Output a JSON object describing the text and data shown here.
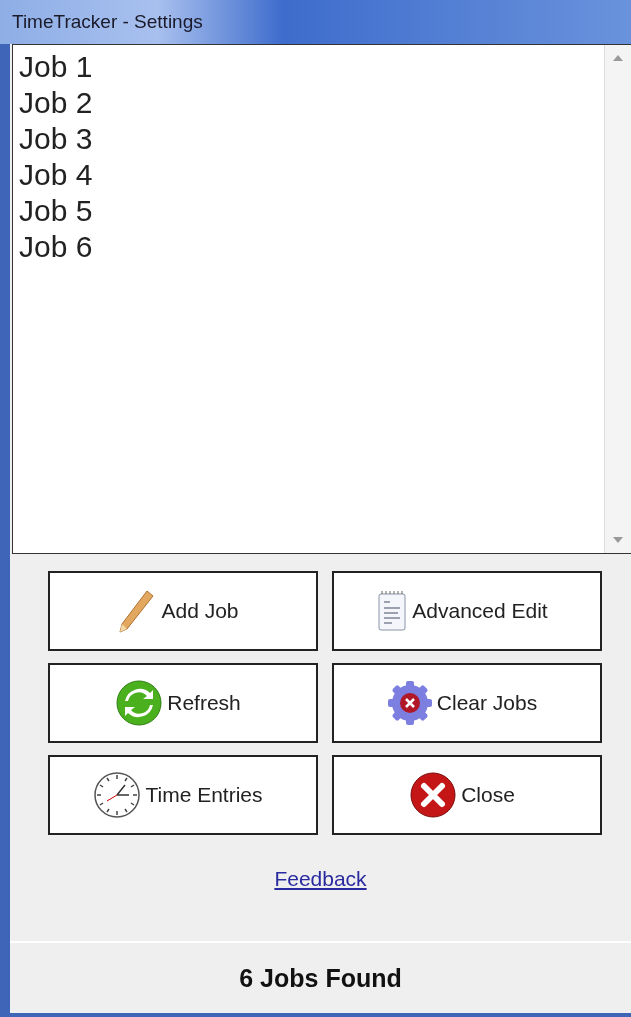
{
  "window": {
    "title": "TimeTracker - Settings"
  },
  "jobs": [
    {
      "label": "Job 1"
    },
    {
      "label": "Job 2"
    },
    {
      "label": "Job 3"
    },
    {
      "label": "Job 4"
    },
    {
      "label": "Job 5"
    },
    {
      "label": "Job 6"
    }
  ],
  "buttons": [
    {
      "label": "Add Job"
    },
    {
      "label": "Advanced Edit"
    },
    {
      "label": "Refresh"
    },
    {
      "label": "Clear Jobs"
    },
    {
      "label": "Time Entries"
    },
    {
      "label": "Close"
    }
  ],
  "link": "Feedback",
  "status_bar": "6 Jobs Found"
}
